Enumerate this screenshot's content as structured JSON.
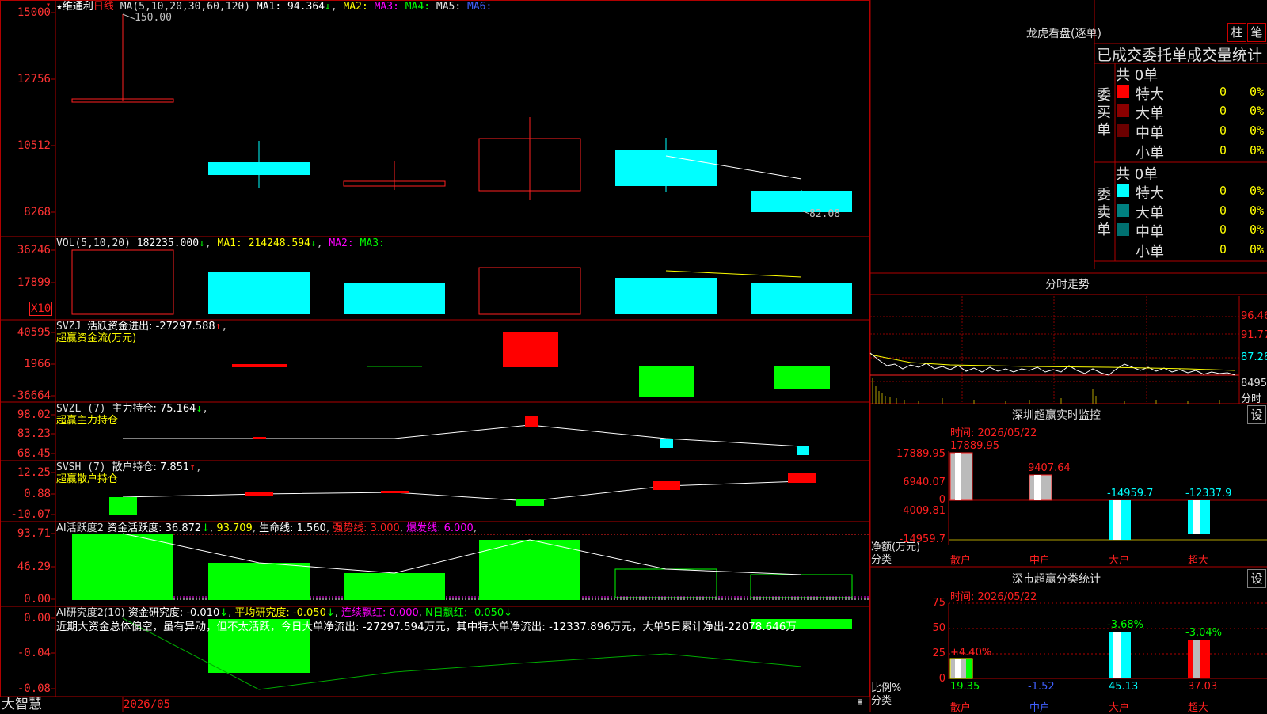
{
  "k": {
    "star": "★",
    "name": "维通利",
    "period": "日线",
    "ma_def": "MA(5,10,20,30,60,120)",
    "ma1": "MA1: 94.364",
    "ma1_arrow": "↓",
    "ma2": "MA2:",
    "ma3": "MA3:",
    "ma4": "MA4:",
    "ma5": "MA5:",
    "ma6": "MA6:",
    "ymarks": [
      "15000",
      "12756",
      "10512",
      "8268"
    ],
    "hi_label": "150.00",
    "lo_label": "82.08"
  },
  "vol": {
    "def": "VOL(5,10,20)",
    "val": "182235.000",
    "arrow": "↓",
    "ma1": "MA1: 214248.594",
    "ma1_arrow": "↓",
    "ma2": "MA2:",
    "ma3": "MA3:",
    "ymarks": [
      "36246",
      "17899"
    ],
    "unit": "X10"
  },
  "svzj": {
    "name": "SVZJ",
    "line1": "活跃资金进出: -27297.588",
    "arrow": "↑",
    "line2": "超赢资金流(万元)",
    "ymarks": [
      "40595",
      "1966",
      "-36664"
    ]
  },
  "svzl": {
    "name": "SVZL (7)",
    "line1": "主力持仓: 75.164",
    "arrow": "↓",
    "line2": "超赢主力持仓",
    "ymarks": [
      "98.02",
      "83.23",
      "68.45"
    ]
  },
  "svsh": {
    "name": "SVSH (7)",
    "line1": "散户持仓: 7.851",
    "arrow": "↑",
    "line2": "超赢散户持仓",
    "ymarks": [
      "12.25",
      "0.88",
      "-10.07"
    ]
  },
  "ai1": {
    "name": "AI活跃度2",
    "l1": "资金活跃度: 36.872",
    "a1": "↓",
    "l2": "93.709",
    "l3": "生命线: 1.560",
    "l4": "强势线: 3.000",
    "l5": "爆发线: 6.000",
    "ymarks": [
      "93.71",
      "46.29",
      "0.00"
    ]
  },
  "ai2": {
    "name": "AI研究度2(10)",
    "l1": "资金研究度: -0.010",
    "a1": "↓",
    "l2": "平均研究度: -0.050",
    "a2": "↓",
    "l3": "连续飘红: 0.000",
    "l4": "N日飘红: -0.050",
    "a4": "↓",
    "summary": "近期大资金总体偏空，虽有异动，但不太活跃，今日大单净流出: -27297.594万元，其中特大单净流出: -12337.896万元，大单5日累计净出-22078.646万",
    "ymarks": [
      "0.00",
      "-0.04",
      "-0.08"
    ]
  },
  "bottom": {
    "brand": "大智慧",
    "date": "2026/05"
  },
  "right": {
    "title": "龙虎看盘(逐单)",
    "btn_a": "柱",
    "btn_b": "笔",
    "subtitle": "已成交委托单成交量统计",
    "buy": {
      "side": "委买单",
      "total": "共 0单",
      "rows": [
        {
          "label": "特大",
          "count": "0",
          "pct": "0%",
          "color": "#ff0000"
        },
        {
          "label": "大单",
          "count": "0",
          "pct": "0%",
          "color": "#8b0000"
        },
        {
          "label": "中单",
          "count": "0",
          "pct": "0%",
          "color": "#6b0000"
        },
        {
          "label": "小单",
          "count": "0",
          "pct": "0%",
          "color": ""
        }
      ]
    },
    "sell": {
      "side": "委卖单",
      "total": "共 0单",
      "rows": [
        {
          "label": "特大",
          "count": "0",
          "pct": "0%",
          "color": "#00ffff"
        },
        {
          "label": "大单",
          "count": "0",
          "pct": "0%",
          "color": "#008080"
        },
        {
          "label": "中单",
          "count": "0",
          "pct": "0%",
          "color": "#007070"
        },
        {
          "label": "小单",
          "count": "0",
          "pct": "0%",
          "color": ""
        }
      ]
    },
    "fenshi": {
      "title": "分时走势",
      "ymarks": [
        "96.46",
        "91.77",
        "87.28",
        "8495"
      ],
      "unit": "分时"
    },
    "sz": {
      "title": "深圳超赢实时监控",
      "btn": "设",
      "time": "时间: 2026/05/22",
      "ymarks": [
        "17889.95",
        "6940.07",
        "0",
        "-4009.81",
        "-14959.7"
      ],
      "ylabel": "净额(万元)",
      "xlabel": "分类",
      "bars": [
        {
          "cat": "散户",
          "val": 17889.95,
          "label": "17889.95"
        },
        {
          "cat": "中户",
          "val": 9407.64,
          "label": "9407.64"
        },
        {
          "cat": "大户",
          "val": -14959.7,
          "label": "-14959.7"
        },
        {
          "cat": "超大",
          "val": -12337.9,
          "label": "-12337.9"
        }
      ]
    },
    "fl": {
      "title": "深市超赢分类统计",
      "btn": "设",
      "time": "时间: 2026/05/22",
      "ymarks": [
        "75",
        "50",
        "25",
        "0"
      ],
      "ylabel": "比例%",
      "xlabel": "分类",
      "bars": [
        {
          "cat": "散户",
          "pct": 19.35,
          "chg": "+4.40%",
          "label": "19.35"
        },
        {
          "cat": "中户",
          "pct": 0,
          "chg": "",
          "label": "-1.52"
        },
        {
          "cat": "大户",
          "pct": 45.13,
          "chg": "-3.68%",
          "label": "45.13"
        },
        {
          "cat": "超大",
          "pct": 37.03,
          "chg": "-3.04%",
          "label": "37.03"
        }
      ]
    }
  },
  "chart_data": [
    {
      "type": "candlestick",
      "title": "维通利 日线",
      "candles": [
        {
          "open": null,
          "close": null,
          "high": 150.0,
          "low": null,
          "color": "red"
        },
        {
          "open": 101,
          "close": 98,
          "high": 106,
          "low": 94,
          "color": "cyan"
        },
        {
          "open": 96,
          "close": 97,
          "high": 102,
          "low": 95,
          "color": "red"
        },
        {
          "open": 97,
          "close": 104,
          "high": 108,
          "low": 95,
          "color": "red"
        },
        {
          "open": 103,
          "close": 96,
          "high": 105,
          "low": 94,
          "color": "cyan"
        },
        {
          "open": 91,
          "close": 88,
          "high": 91,
          "low": 82.08,
          "color": "cyan"
        }
      ]
    },
    {
      "type": "bar",
      "title": "VOL",
      "values": [
        32000,
        21000,
        19000,
        23000,
        18500,
        18200
      ],
      "ylim": [
        0,
        36246
      ]
    },
    {
      "type": "bar",
      "title": "SVZJ",
      "values": [
        0,
        -1500,
        0,
        40595,
        -36664,
        -27297.588
      ]
    },
    {
      "type": "bar",
      "title": "AI活跃度2",
      "values": [
        93.709,
        46.0,
        34.0,
        75.0,
        36.0,
        30.0
      ]
    }
  ]
}
